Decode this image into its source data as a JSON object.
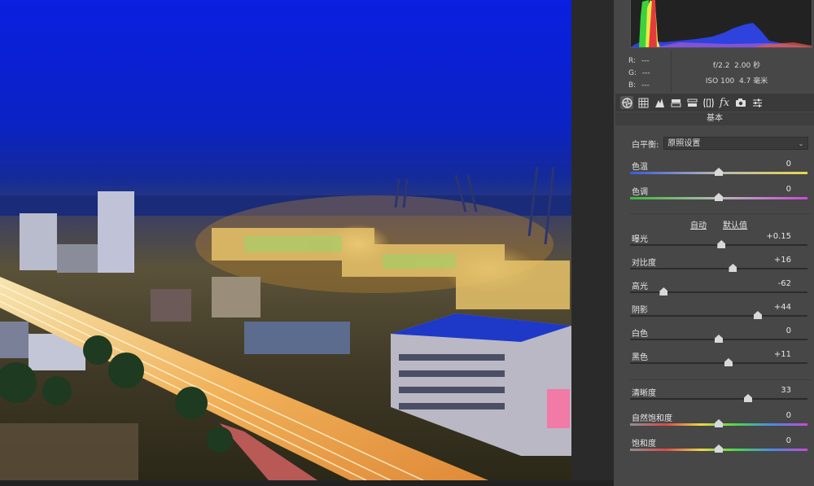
{
  "histogram": {
    "readout": {
      "r_label": "R:",
      "r_value": "---",
      "g_label": "G:",
      "g_value": "---",
      "b_label": "B:",
      "b_value": "---",
      "aperture": "f/2.2",
      "shutter": "2.00 秒",
      "iso": "ISO 100",
      "focal_length": "4.7 毫米"
    }
  },
  "toolbar": {
    "icons": [
      "aperture-icon",
      "grid-icon",
      "tone-curve-icon",
      "split-tone-icon",
      "detail-icon",
      "lens-icon",
      "fx-icon",
      "camera-icon",
      "sliders-icon"
    ],
    "fx_label": "fx"
  },
  "panel": {
    "section_title": "基本",
    "white_balance": {
      "label": "白平衡:",
      "value": "原照设置"
    },
    "auto_label": "自动",
    "default_label": "默认值",
    "sliders": [
      {
        "id": "temp",
        "label": "色温",
        "value": "0",
        "position": 0.5,
        "track": "temp"
      },
      {
        "id": "tint",
        "label": "色调",
        "value": "0",
        "position": 0.5,
        "track": "tint"
      },
      {
        "id": "exposure",
        "label": "曝光",
        "value": "+0.15",
        "position": 0.515
      },
      {
        "id": "contrast",
        "label": "对比度",
        "value": "+16",
        "position": 0.58
      },
      {
        "id": "highlights",
        "label": "高光",
        "value": "-62",
        "position": 0.19
      },
      {
        "id": "shadows",
        "label": "阴影",
        "value": "+44",
        "position": 0.72
      },
      {
        "id": "whites",
        "label": "白色",
        "value": "0",
        "position": 0.5
      },
      {
        "id": "blacks",
        "label": "黑色",
        "value": "+11",
        "position": 0.555
      },
      {
        "id": "clarity",
        "label": "清晰度",
        "value": "33",
        "position": 0.665,
        "track": "dark"
      },
      {
        "id": "vibrance",
        "label": "自然饱和度",
        "value": "0",
        "position": 0.5,
        "track": "sat"
      },
      {
        "id": "saturation",
        "label": "饱和度",
        "value": "0",
        "position": 0.5,
        "track": "sat"
      }
    ]
  },
  "colors": {
    "panel_bg": "#474747",
    "sky": "#0b1ed8",
    "accent_light": "#f4b548"
  }
}
